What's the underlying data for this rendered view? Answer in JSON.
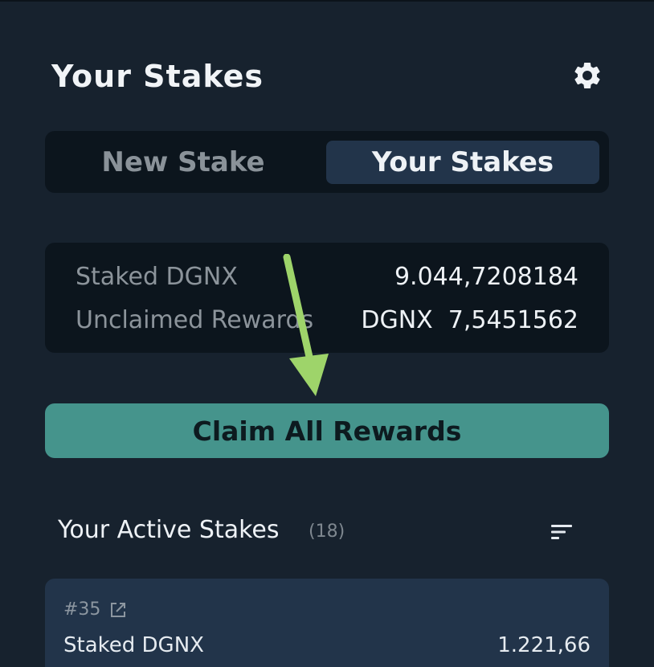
{
  "header": {
    "title": "Your Stakes",
    "settings_icon": "gear-icon"
  },
  "tabs": [
    {
      "label": "New Stake",
      "active": false
    },
    {
      "label": "Your Stakes",
      "active": true
    }
  ],
  "summary": {
    "staked_label": "Staked DGNX",
    "staked_value": "9.044,7208184",
    "rewards_label": "Unclaimed Rewards",
    "rewards_value": "DGNX  7,5451562"
  },
  "claim_button": {
    "label": "Claim All Rewards"
  },
  "active_stakes": {
    "title": "Your Active Stakes",
    "count": "(18)",
    "sort_icon": "sort-icon"
  },
  "stake_card": {
    "id": "#35",
    "link_icon": "external-link-icon",
    "row_label": "Staked DGNX",
    "row_value": "1.221,66"
  },
  "colors": {
    "background": "#17222e",
    "panel": "#0c151d",
    "active_tab": "#22344a",
    "accent_button": "#45948c",
    "annotation_arrow": "#9ed46a"
  }
}
